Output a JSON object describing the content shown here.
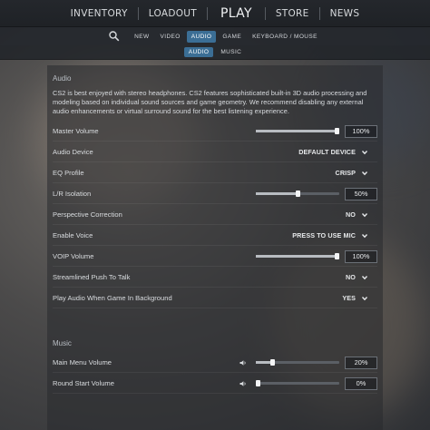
{
  "top_nav": {
    "items": [
      "INVENTORY",
      "LOADOUT",
      "PLAY",
      "STORE",
      "NEWS"
    ]
  },
  "settings_tabs": {
    "items": [
      "NEW",
      "VIDEO",
      "AUDIO",
      "GAME",
      "KEYBOARD / MOUSE"
    ],
    "active": "AUDIO"
  },
  "audio_subtabs": {
    "items": [
      "AUDIO",
      "MUSIC"
    ],
    "active": "AUDIO"
  },
  "audio_section": {
    "title": "Audio",
    "intro": "CS2 is best enjoyed with stereo headphones. CS2 features sophisticated built-in 3D audio processing and modeling based on individual sound sources and game geometry. We recommend disabling any external audio enhancements or virtual surround sound for the best listening experience.",
    "rows": [
      {
        "label": "Master Volume",
        "type": "slider",
        "value_text": "100%",
        "fraction": 1.0
      },
      {
        "label": "Audio Device",
        "type": "dropdown",
        "value_text": "DEFAULT DEVICE"
      },
      {
        "label": "EQ Profile",
        "type": "dropdown",
        "value_text": "CRISP"
      },
      {
        "label": "L/R Isolation",
        "type": "slider",
        "value_text": "50%",
        "fraction": 0.5
      },
      {
        "label": "Perspective Correction",
        "type": "dropdown",
        "value_text": "NO"
      },
      {
        "label": "Enable Voice",
        "type": "dropdown",
        "value_text": "PRESS TO USE MIC"
      },
      {
        "label": "VOIP Volume",
        "type": "slider",
        "value_text": "100%",
        "fraction": 1.0
      },
      {
        "label": "Streamlined Push To Talk",
        "type": "dropdown",
        "value_text": "NO"
      },
      {
        "label": "Play Audio When Game In Background",
        "type": "dropdown",
        "value_text": "YES"
      }
    ]
  },
  "music_section": {
    "title": "Music",
    "rows": [
      {
        "label": "Main Menu Volume",
        "type": "slider",
        "value_text": "20%",
        "fraction": 0.2
      },
      {
        "label": "Round Start Volume",
        "type": "slider",
        "value_text": "0%",
        "fraction": 0.0
      }
    ]
  },
  "colors": {
    "accent": "#3b6e95",
    "topbar": "#24272c",
    "text": "#d9dcdf"
  }
}
